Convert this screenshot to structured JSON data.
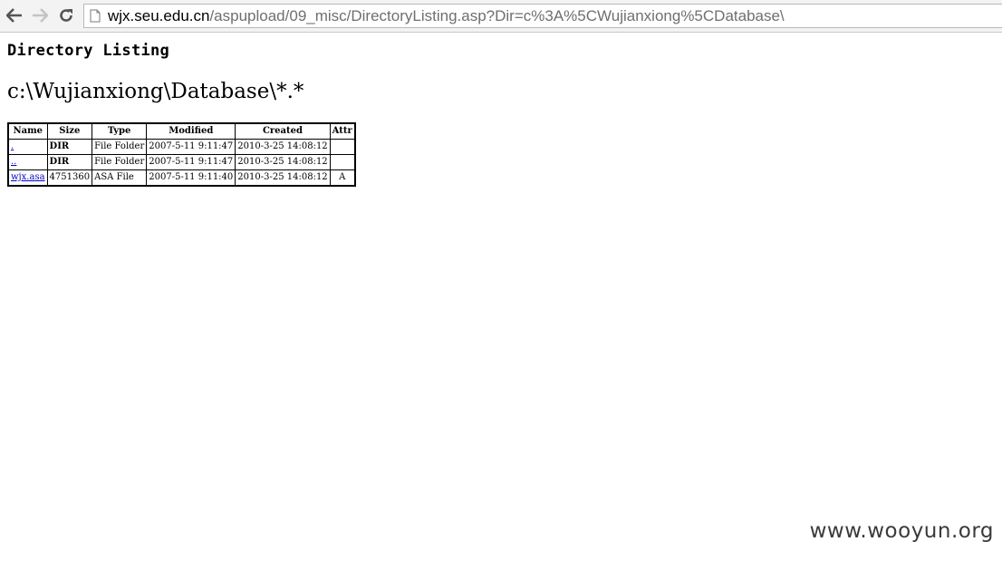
{
  "browser": {
    "url_host": "wjx.seu.edu.cn",
    "url_path": "/aspupload/09_misc/DirectoryListing.asp?Dir=c%3A%5CWujianxiong%5CDatabase\\"
  },
  "page": {
    "title": "Directory Listing",
    "path": "c:\\Wujianxiong\\Database\\*.*"
  },
  "table": {
    "headers": [
      "Name",
      "Size",
      "Type",
      "Modified",
      "Created",
      "Attr"
    ],
    "rows": [
      {
        "name": ".",
        "size": "DIR",
        "type": "File Folder",
        "modified": "2007-5-11 9:11:47",
        "created": "2010-3-25 14:08:12",
        "attr": ""
      },
      {
        "name": "..",
        "size": "DIR",
        "type": "File Folder",
        "modified": "2007-5-11 9:11:47",
        "created": "2010-3-25 14:08:12",
        "attr": ""
      },
      {
        "name": "wjx.asa",
        "size": "4751360",
        "type": "ASA File",
        "modified": "2007-5-11 9:11:40",
        "created": "2010-3-25 14:08:12",
        "attr": "A"
      }
    ]
  },
  "watermark": "www.wooyun.org"
}
